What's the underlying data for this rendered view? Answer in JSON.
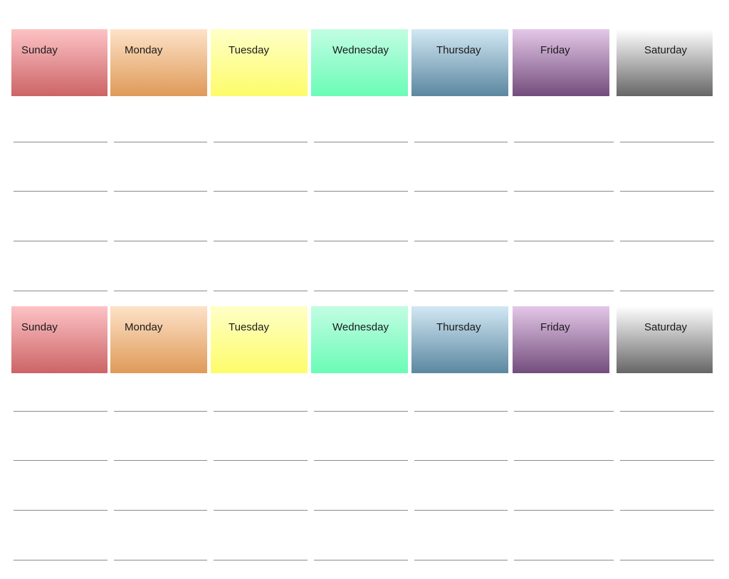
{
  "weeks": [
    {
      "days": [
        "Sunday",
        "Monday",
        "Tuesday",
        "Wednesday",
        "Thursday",
        "Friday",
        "Saturday"
      ]
    },
    {
      "days": [
        "Sunday",
        "Monday",
        "Tuesday",
        "Wednesday",
        "Thursday",
        "Friday",
        "Saturday"
      ]
    }
  ],
  "blank_lines_per_day": 4,
  "colors": {
    "Sunday": [
      "#fdc3c6",
      "#cc6466"
    ],
    "Monday": [
      "#fde2c8",
      "#df9a58"
    ],
    "Tuesday": [
      "#ffffc8",
      "#fdfc6a"
    ],
    "Wednesday": [
      "#c2fde3",
      "#6afcb6"
    ],
    "Thursday": [
      "#d2e8f4",
      "#5b87a0"
    ],
    "Friday": [
      "#e4c8e8",
      "#734d7c"
    ],
    "Saturday": [
      "#ffffff",
      "#666666"
    ]
  }
}
